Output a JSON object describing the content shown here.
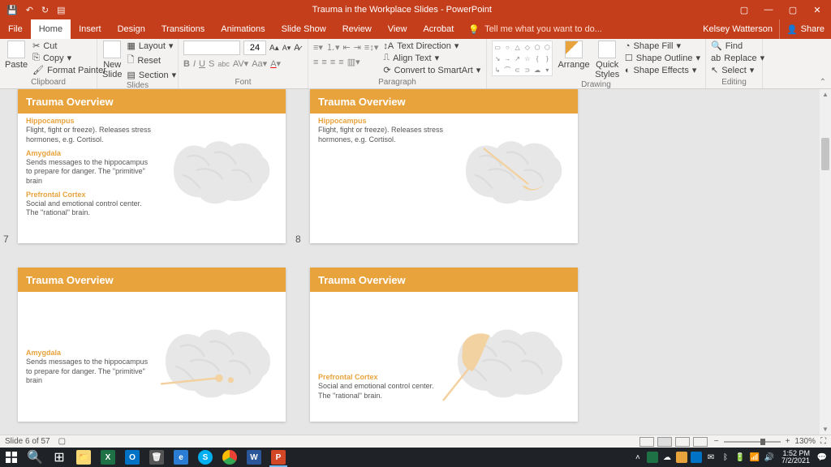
{
  "titlebar": {
    "title": "Trauma in the Workplace Slides - PowerPoint"
  },
  "tabs": {
    "file": "File",
    "home": "Home",
    "insert": "Insert",
    "design": "Design",
    "transitions": "Transitions",
    "animations": "Animations",
    "slideshow": "Slide Show",
    "review": "Review",
    "view": "View",
    "acrobat": "Acrobat",
    "tellme": "Tell me what you want to do...",
    "user": "Kelsey Watterson",
    "share": "Share"
  },
  "ribbon": {
    "clipboard": {
      "paste": "Paste",
      "cut": "Cut",
      "copy": "Copy",
      "painter": "Format Painter",
      "label": "Clipboard"
    },
    "slides": {
      "new": "New\nSlide",
      "layout": "Layout",
      "reset": "Reset",
      "section": "Section",
      "label": "Slides"
    },
    "font": {
      "size": "24",
      "label": "Font"
    },
    "paragraph": {
      "textdir": "Text Direction",
      "align": "Align Text",
      "smartart": "Convert to SmartArt",
      "label": "Paragraph"
    },
    "drawing": {
      "arrange": "Arrange",
      "quick": "Quick\nStyles",
      "fill": "Shape Fill",
      "outline": "Shape Outline",
      "effects": "Shape Effects",
      "label": "Drawing"
    },
    "editing": {
      "find": "Find",
      "replace": "Replace",
      "select": "Select",
      "label": "Editing"
    }
  },
  "slides": [
    {
      "num": "7",
      "title": "Trauma Overview",
      "blocks": [
        {
          "h": "Hippocampus",
          "t": "Flight, fight or freeze). Releases stress hormones, e.g. Cortisol."
        },
        {
          "h": "Amygdala",
          "t": "Sends messages to the hippocampus to prepare for danger. The \"primitive\" brain"
        },
        {
          "h": "Prefrontal Cortex",
          "t": "Social and emotional control center. The \"rational\" brain."
        }
      ],
      "variant": "plain"
    },
    {
      "num": "8",
      "title": "Trauma Overview",
      "blocks": [
        {
          "h": "Hippocampus",
          "t": "Flight, fight or freeze). Releases stress hormones, e.g. Cortisol."
        }
      ],
      "variant": "hippocampus"
    },
    {
      "num": "",
      "title": "Trauma Overview",
      "blocks": [
        {
          "h": "Amygdala",
          "t": "Sends messages to the hippocampus to prepare for danger. The \"primitive\" brain"
        }
      ],
      "variant": "amygdala"
    },
    {
      "num": "",
      "title": "Trauma Overview",
      "blocks": [
        {
          "h": "Prefrontal Cortex",
          "t": "Social and emotional control center. The \"rational\" brain."
        }
      ],
      "variant": "prefrontal"
    }
  ],
  "status": {
    "left": "Slide 6 of 57",
    "zoom": "130%"
  },
  "tray": {
    "time": "1:52 PM",
    "date": "7/2/2021"
  }
}
